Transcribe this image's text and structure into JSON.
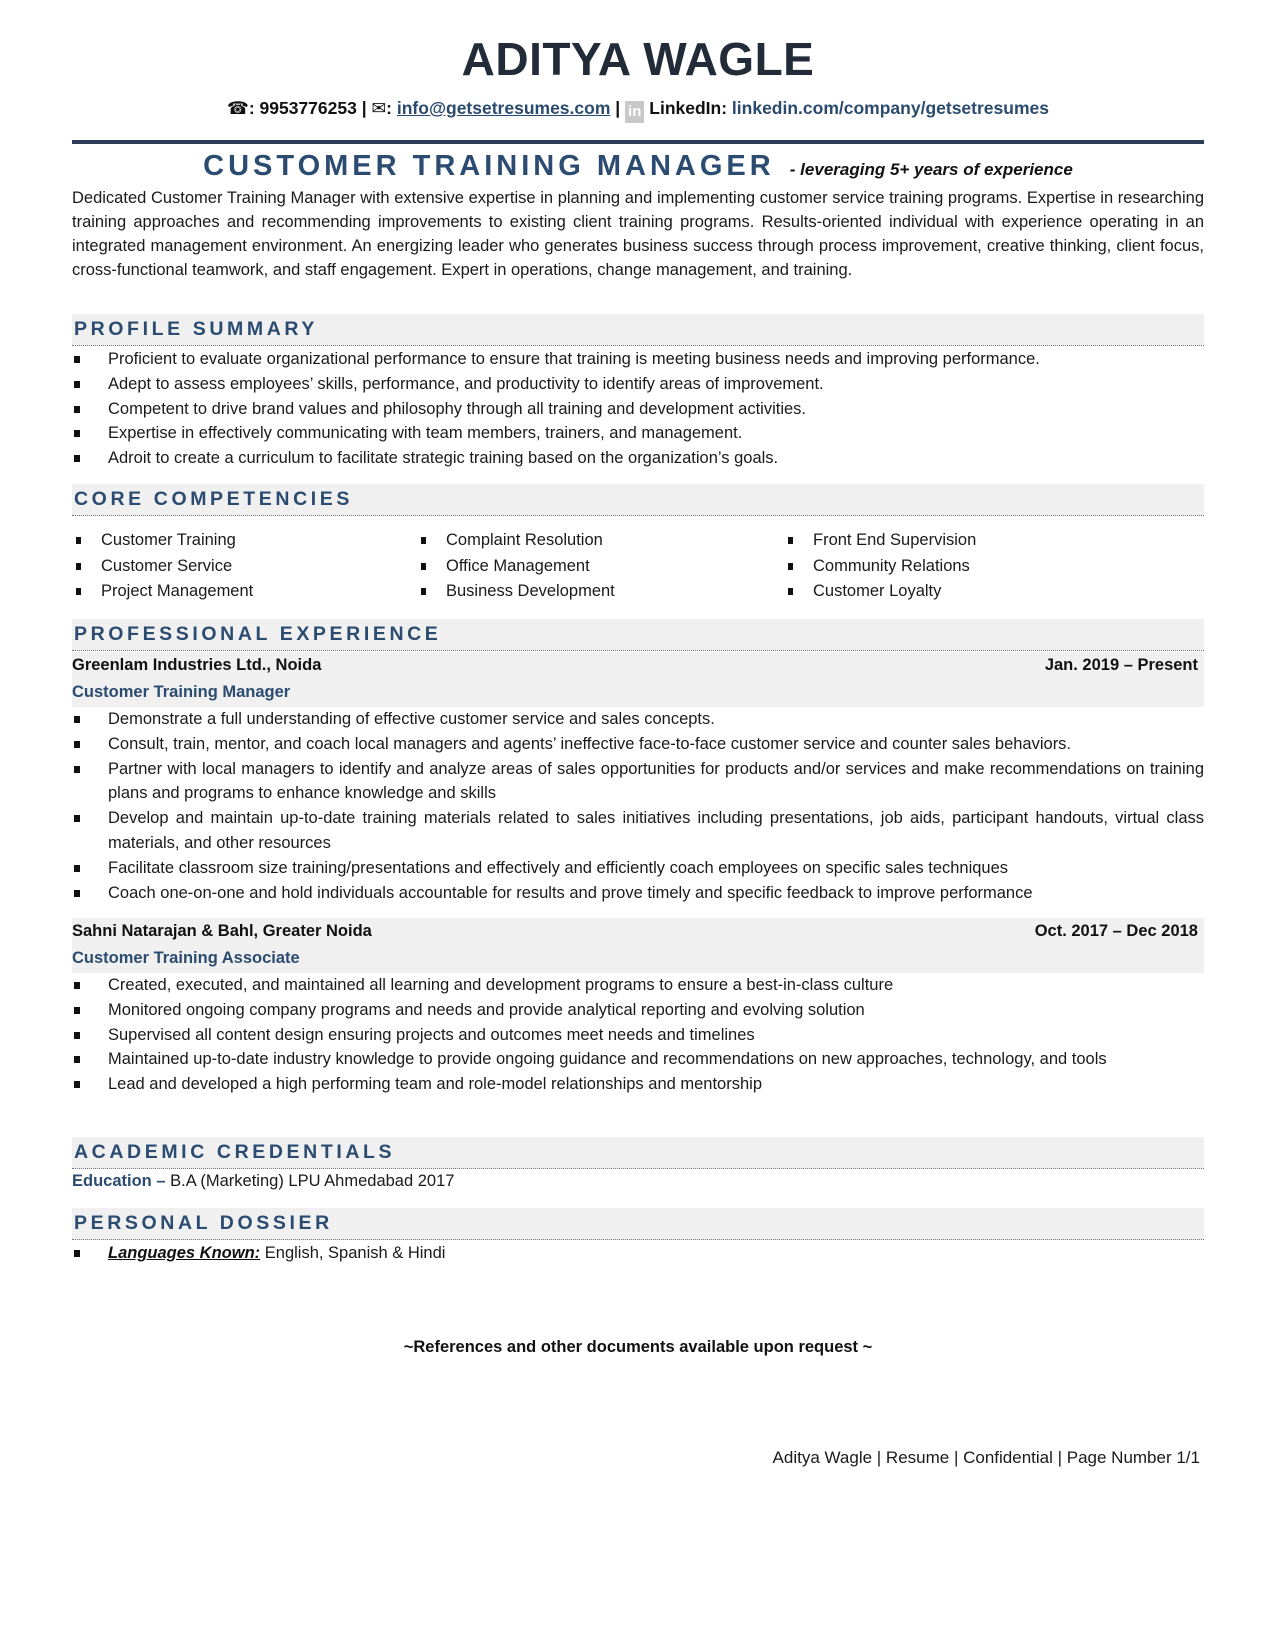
{
  "header": {
    "name": "ADITYA WAGLE",
    "phone_icon": "phone-icon",
    "phone": "9953776253",
    "email_icon": "envelope-icon",
    "email": "info@getsetresumes.com",
    "linkedin_icon": "linkedin-icon",
    "linkedin_label": "LinkedIn:",
    "linkedin_url": "linkedin.com/company/getsetresumes",
    "separator": "|"
  },
  "title": {
    "job_title": "CUSTOMER TRAINING MANAGER",
    "tagline": "- leveraging 5+ years of experience"
  },
  "summary": "Dedicated Customer Training Manager with extensive expertise in planning and implementing customer service training programs. Expertise in researching training approaches and recommending improvements to existing client training programs. Results-oriented individual with experience operating in an integrated management environment. An energizing leader who generates business success through process improvement, creative thinking, client focus, cross-functional teamwork, and staff engagement. Expert in operations, change management, and training.",
  "sections": {
    "profile_summary": "PROFILE SUMMARY",
    "core_competencies": "CORE COMPETENCIES",
    "professional_experience": "PROFESSIONAL EXPERIENCE",
    "academic_credentials": "ACADEMIC CREDENTIALS",
    "personal_dossier": "PERSONAL DOSSIER"
  },
  "profile_summary": [
    "Proficient to evaluate organizational performance to ensure that training is meeting business needs and improving performance.",
    "Adept to assess employees’ skills, performance, and productivity to identify areas of improvement.",
    "Competent to drive brand values and philosophy through all training and development activities.",
    "Expertise in effectively communicating with team members, trainers, and management.",
    "Adroit to create a curriculum to facilitate strategic training based on the organization’s goals."
  ],
  "core_competencies": {
    "col1": [
      "Customer Training",
      "Customer Service",
      "Project Management"
    ],
    "col2": [
      "Complaint Resolution",
      "Office Management",
      "Business Development"
    ],
    "col3": [
      "Front End Supervision",
      "Community Relations",
      "Customer Loyalty"
    ]
  },
  "experience": [
    {
      "company": "Greenlam Industries Ltd., Noida",
      "dates": "Jan. 2019 – Present",
      "role": "Customer Training Manager",
      "bullets": [
        "Demonstrate a full understanding of effective customer service and sales concepts.",
        "Consult, train, mentor, and coach local managers and agents’ ineffective face-to-face customer service and counter sales behaviors.",
        "Partner with local managers to identify and analyze areas of sales opportunities for products and/or services and make recommendations on training plans and programs to enhance knowledge and skills",
        "Develop and maintain up-to-date training materials related to sales initiatives including presentations, job aids, participant handouts, virtual class materials, and other resources",
        "Facilitate classroom size training/presentations and effectively and efficiently coach employees on specific sales techniques",
        "Coach one-on-one and hold individuals accountable for results and prove timely and specific feedback to improve performance"
      ]
    },
    {
      "company": "Sahni Natarajan & Bahl, Greater Noida",
      "dates": "Oct. 2017 – Dec 2018",
      "role": "Customer Training Associate",
      "bullets": [
        "Created, executed, and maintained all learning and development programs to ensure a best-in-class culture",
        "Monitored ongoing company programs and needs and provide analytical reporting and evolving solution",
        "Supervised all content design ensuring projects and outcomes meet needs and timelines",
        "Maintained up-to-date industry knowledge to provide ongoing guidance and recommendations on new approaches, technology, and tools",
        "Lead and developed a high performing team and role-model relationships and mentorship"
      ]
    }
  ],
  "education": {
    "label": "Education –",
    "value": "B.A (Marketing) LPU Ahmedabad 2017"
  },
  "personal": {
    "languages_label": "Languages Known:",
    "languages_value": "English, Spanish & Hindi"
  },
  "references": "~References and other documents available upon request ~",
  "footer": "Aditya Wagle | Resume | Confidential | Page Number 1/1"
}
